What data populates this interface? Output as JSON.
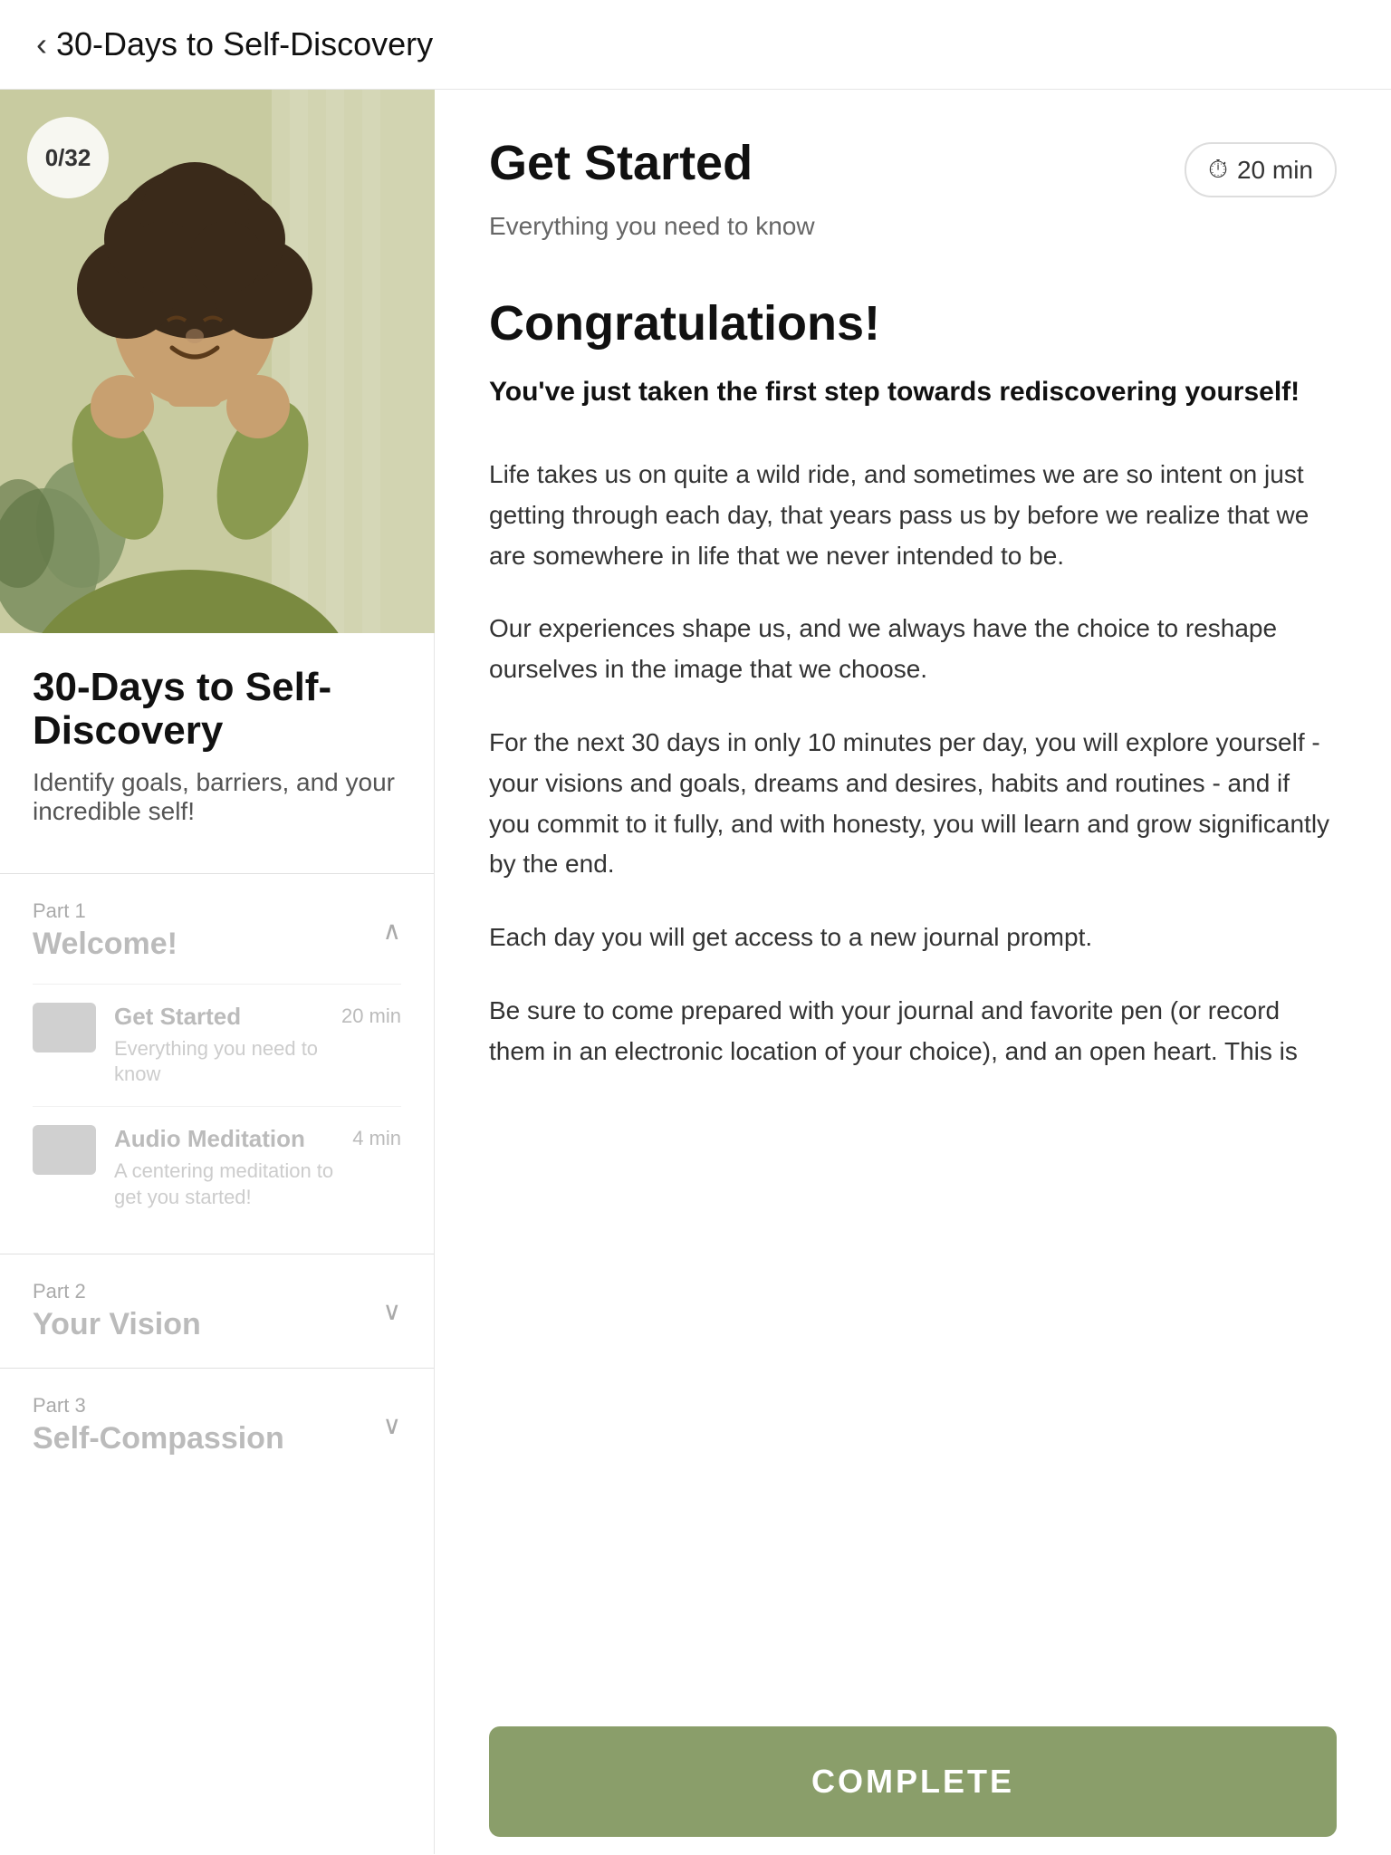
{
  "header": {
    "back_label": "30-Days to Self-Discovery",
    "back_icon": "‹"
  },
  "left": {
    "progress": "0/32",
    "course_title": "30-Days to Self-Discovery",
    "course_subtitle": "Identify goals, barriers, and your incredible self!",
    "parts": [
      {
        "label": "Part 1",
        "name": "Welcome!",
        "chevron": "∧",
        "expanded": true,
        "lessons": [
          {
            "title": "Get Started",
            "description": "Everything you need to know",
            "duration": "20 min"
          },
          {
            "title": "Audio Meditation",
            "description": "A centering meditation to get you started!",
            "duration": "4 min"
          }
        ]
      },
      {
        "label": "Part 2",
        "name": "Your Vision",
        "chevron": "∨",
        "expanded": false,
        "lessons": []
      },
      {
        "label": "Part 3",
        "name": "Self-Compassion",
        "chevron": "∨",
        "expanded": false,
        "lessons": []
      }
    ]
  },
  "right": {
    "lesson_name": "Get Started",
    "lesson_tagline": "Everything you need to know",
    "duration": "20 min",
    "clock_icon": "🕐",
    "congratulations": "Congratulations!",
    "congrats_sub": "You've just taken the first step towards rediscovering yourself!",
    "body_paragraphs": [
      "Life takes us on quite a wild ride, and sometimes we are so intent on just getting through each day, that years pass us by before we realize that we are somewhere in life that we never intended to be.",
      "Our experiences shape us, and we always have the choice to reshape ourselves in the image that we choose.",
      "For the next 30 days in only 10 minutes per day, you will explore yourself - your visions and goals, dreams and desires, habits and routines - and if you commit to it fully, and with honesty, you will learn and grow significantly by the end.",
      "Each day you will get access to a new journal prompt.",
      "Be sure to come prepared with your journal and favorite pen (or record them in an electronic location of your choice), and an open heart. This is"
    ],
    "complete_label": "COMPLETE"
  }
}
